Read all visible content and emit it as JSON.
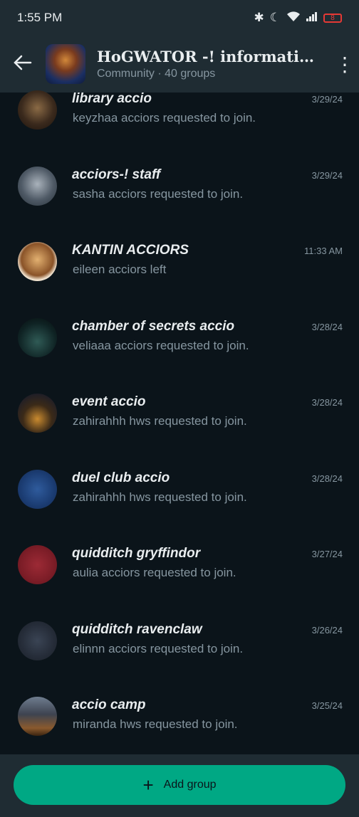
{
  "status_bar": {
    "time": "1:55 PM",
    "battery": "8"
  },
  "header": {
    "title": "HoGWATOR -! information ꝏ ...",
    "subtitle": "Community · 40 groups"
  },
  "groups": [
    {
      "name": "library accio",
      "sub": "keyzhaa acciors requested to join.",
      "time": "3/29/24"
    },
    {
      "name": "acciors-! staff",
      "sub": "sasha acciors requested to join.",
      "time": "3/29/24"
    },
    {
      "name": "KANTIN ACCIORS",
      "sub": "eileen acciors left",
      "time": "11:33 AM"
    },
    {
      "name": "chamber of secrets accio",
      "sub": "veliaaa acciors requested to join.",
      "time": "3/28/24"
    },
    {
      "name": "event accio",
      "sub": "zahirahhh hws requested to join.",
      "time": "3/28/24"
    },
    {
      "name": "duel club accio",
      "sub": "zahirahhh hws requested to join.",
      "time": "3/28/24"
    },
    {
      "name": "quidditch gryffindor",
      "sub": "aulia acciors requested to join.",
      "time": "3/27/24"
    },
    {
      "name": "quidditch ravenclaw",
      "sub": "elinnn acciors requested to join.",
      "time": "3/26/24"
    },
    {
      "name": "accio camp",
      "sub": "miranda hws requested to join.",
      "time": "3/25/24"
    }
  ],
  "add_group": {
    "label": "Add group"
  },
  "colors": {
    "background": "#0b141a",
    "header": "#1f2c33",
    "accent": "#00a884"
  }
}
